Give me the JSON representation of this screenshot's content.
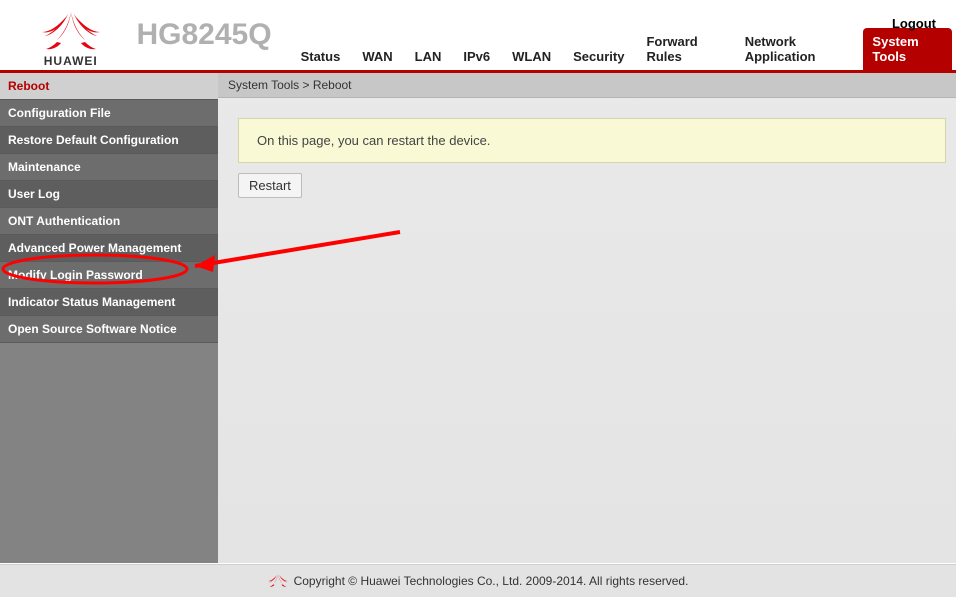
{
  "header": {
    "brand": "HUAWEI",
    "model": "HG8245Q",
    "logout": "Logout"
  },
  "topnav": {
    "items": [
      {
        "label": "Status"
      },
      {
        "label": "WAN"
      },
      {
        "label": "LAN"
      },
      {
        "label": "IPv6"
      },
      {
        "label": "WLAN"
      },
      {
        "label": "Security"
      },
      {
        "label": "Forward Rules"
      },
      {
        "label": "Network Application"
      },
      {
        "label": "System Tools"
      }
    ],
    "activeIndex": 8
  },
  "sidebar": {
    "items": [
      {
        "label": "Reboot"
      },
      {
        "label": "Configuration File"
      },
      {
        "label": "Restore Default Configuration"
      },
      {
        "label": "Maintenance"
      },
      {
        "label": "User Log"
      },
      {
        "label": "ONT Authentication"
      },
      {
        "label": "Advanced Power Management"
      },
      {
        "label": "Modify Login Password"
      },
      {
        "label": "Indicator Status Management"
      },
      {
        "label": "Open Source Software Notice"
      }
    ],
    "activeIndex": 0
  },
  "breadcrumb": "System Tools > Reboot",
  "panel": {
    "text": "On this page, you can restart the device."
  },
  "buttons": {
    "restart": "Restart"
  },
  "footer": {
    "text": "Copyright © Huawei Technologies Co., Ltd. 2009-2014. All rights reserved."
  }
}
